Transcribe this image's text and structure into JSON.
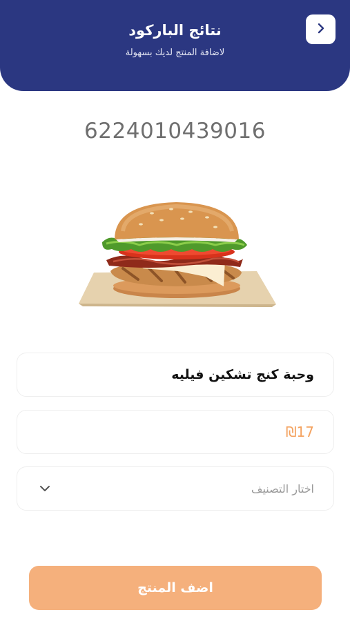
{
  "header": {
    "title": "نتائج الباركود",
    "subtitle": "لاضافة المنتج لديك بسهولة",
    "back_icon": "chevron-right-icon",
    "background_color": "#2b3781"
  },
  "barcode": {
    "number": "6224010439016"
  },
  "product": {
    "image": "burger-image",
    "name": "وحبة كنج تشكين فيليه",
    "price": "₪17",
    "category_placeholder": "اختار التصنيف",
    "category_icon": "chevron-down-icon"
  },
  "actions": {
    "add_label": "اضف المنتج",
    "add_button_color": "#f5b07c"
  }
}
